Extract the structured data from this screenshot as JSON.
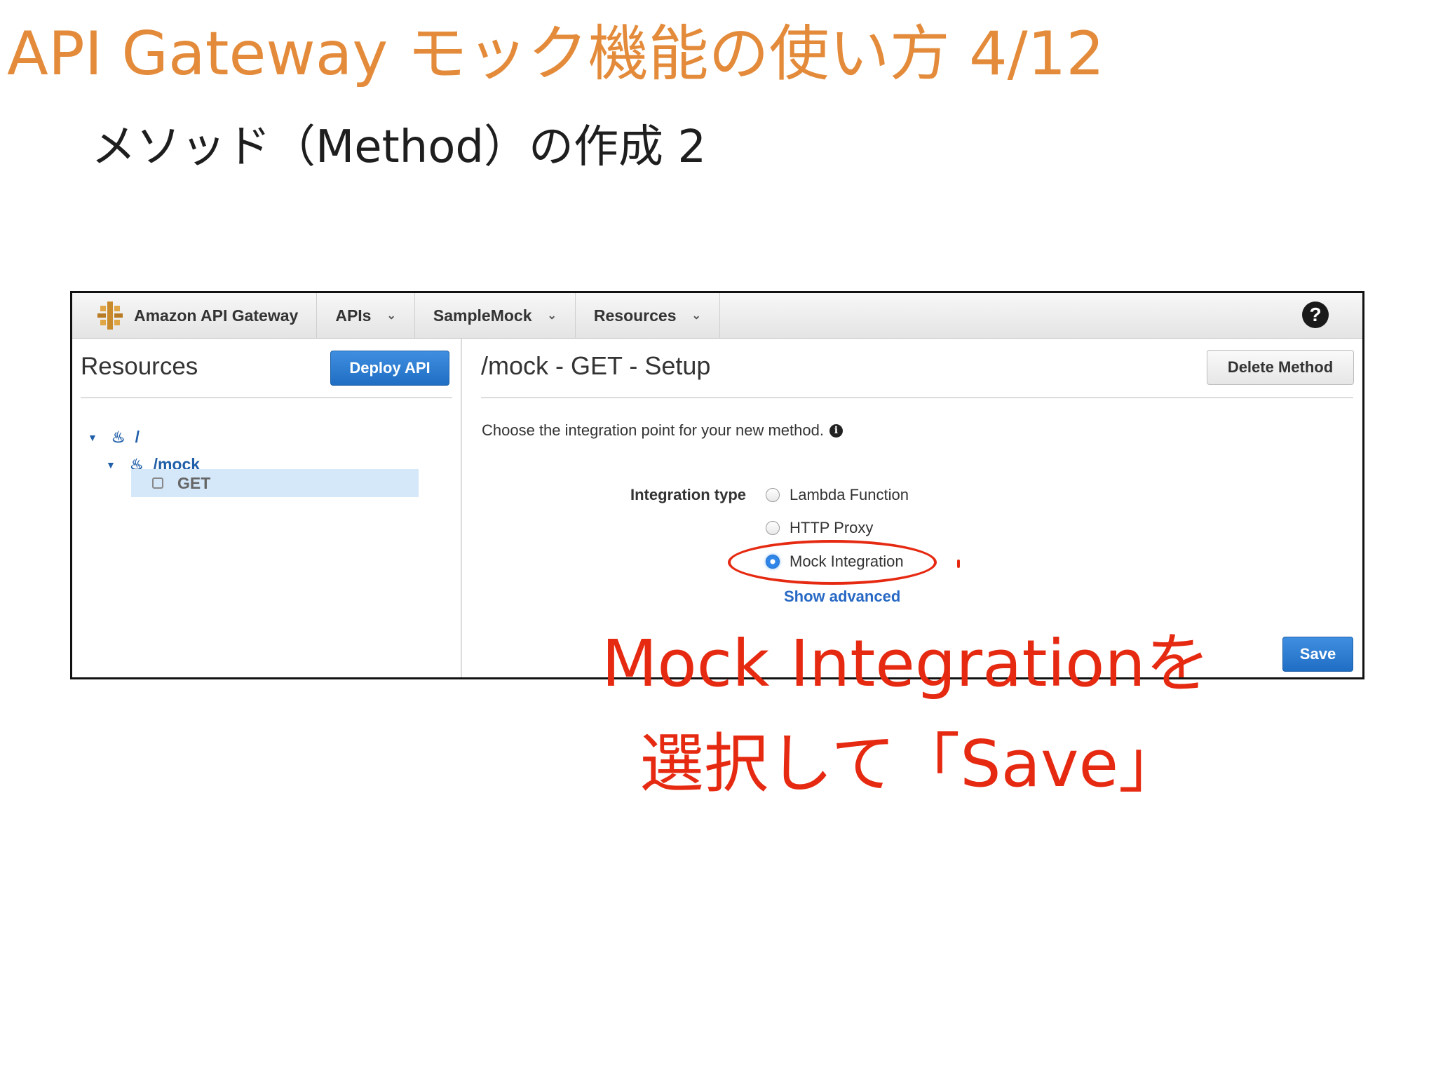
{
  "slide": {
    "title": "API Gateway モック機能の使い方 4/12",
    "subtitle": "メソッド（Method）の作成 2",
    "annotation_line1": "Mock Integrationを",
    "annotation_line2": "選択して「Save」",
    "accent_color": "#e38b3a",
    "annotation_color": "#e62a12"
  },
  "console": {
    "nav": {
      "brand": "Amazon API Gateway",
      "items": [
        {
          "label": "APIs"
        },
        {
          "label": "SampleMock"
        },
        {
          "label": "Resources"
        }
      ],
      "help_icon": "help-icon"
    },
    "left_pane": {
      "heading": "Resources",
      "deploy_button": "Deploy API",
      "tree": {
        "root": "/",
        "child": "/mock",
        "method": "GET"
      }
    },
    "main": {
      "title": "/mock - GET - Setup",
      "delete_button": "Delete Method",
      "prompt": "Choose the integration point for your new method.",
      "integration_label": "Integration type",
      "options": [
        {
          "label": "Lambda Function",
          "selected": false
        },
        {
          "label": "HTTP Proxy",
          "selected": false
        },
        {
          "label": "Mock Integration",
          "selected": true
        }
      ],
      "show_advanced": "Show advanced",
      "save_button": "Save",
      "primary_color": "#2f7fd6"
    }
  }
}
